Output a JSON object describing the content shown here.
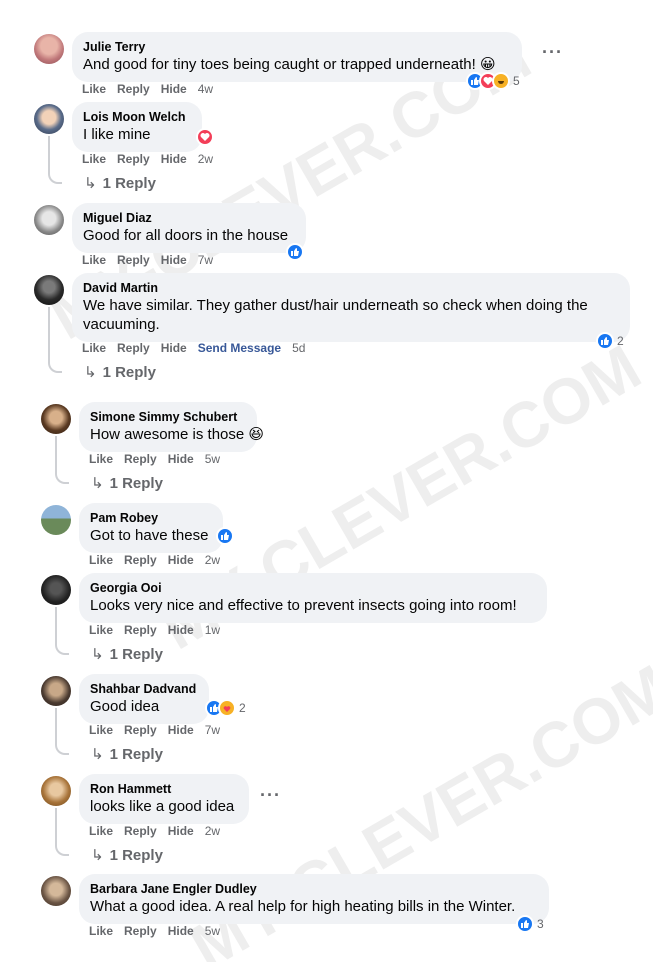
{
  "comments": [
    {
      "author": "Julie Terry",
      "text": "And good for tiny toes being caught or trapped underneath! 😀",
      "actions": {
        "like": "Like",
        "reply": "Reply",
        "hide": "Hide",
        "time": "4w"
      },
      "reactions": {
        "count": "5"
      }
    },
    {
      "author": "Lois Moon Welch",
      "text": "I like mine",
      "actions": {
        "like": "Like",
        "reply": "Reply",
        "hide": "Hide",
        "time": "2w"
      },
      "replies": "1 Reply"
    },
    {
      "author": "Miguel Diaz",
      "text": "Good for all doors in the house",
      "actions": {
        "like": "Like",
        "reply": "Reply",
        "hide": "Hide",
        "time": "7w"
      }
    },
    {
      "author": "David Martin",
      "text": "We have similar. They gather dust/hair underneath so check when doing the vacuuming.",
      "actions": {
        "like": "Like",
        "reply": "Reply",
        "hide": "Hide",
        "send": "Send Message",
        "time": "5d"
      },
      "reactions": {
        "count": "2"
      },
      "replies": "1 Reply"
    },
    {
      "author": "Simone Simmy Schubert",
      "text": "How awesome is those 😆",
      "actions": {
        "like": "Like",
        "reply": "Reply",
        "hide": "Hide",
        "time": "5w"
      },
      "replies": "1 Reply"
    },
    {
      "author": "Pam Robey",
      "text": "Got to have these",
      "actions": {
        "like": "Like",
        "reply": "Reply",
        "hide": "Hide",
        "time": "2w"
      }
    },
    {
      "author": "Georgia Ooi",
      "text": "Looks very nice and effective to prevent insects going into room!",
      "actions": {
        "like": "Like",
        "reply": "Reply",
        "hide": "Hide",
        "time": "1w"
      },
      "replies": "1 Reply"
    },
    {
      "author": "Shahbar Dadvand",
      "text": "Good idea",
      "actions": {
        "like": "Like",
        "reply": "Reply",
        "hide": "Hide",
        "time": "7w"
      },
      "reactions": {
        "count": "2"
      },
      "replies": "1 Reply"
    },
    {
      "author": "Ron Hammett",
      "text": "looks like a good idea",
      "actions": {
        "like": "Like",
        "reply": "Reply",
        "hide": "Hide",
        "time": "2w"
      },
      "replies": "1 Reply"
    },
    {
      "author": "Barbara Jane Engler Dudley",
      "text": "What a good idea. A real help for high heating bills in the Winter.",
      "actions": {
        "like": "Like",
        "reply": "Reply",
        "hide": "Hide",
        "time": "5w"
      },
      "reactions": {
        "count": "3"
      }
    }
  ],
  "more_icon": "···",
  "reply_arrow": "↳",
  "watermark": "MY-CLEVER.COM",
  "colors": {
    "like": "#1877f2",
    "love": "#f33e58",
    "haha": "#f7b125",
    "bubble": "#f0f2f5",
    "meta": "#65676b",
    "link": "#385898"
  }
}
